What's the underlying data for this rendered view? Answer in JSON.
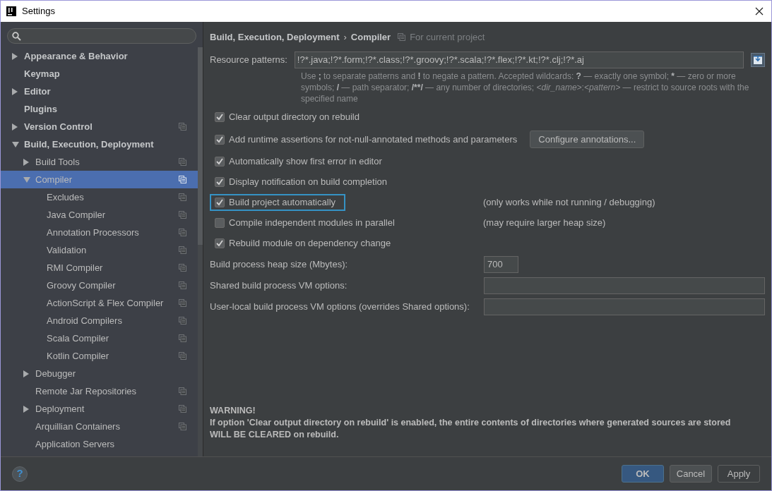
{
  "window": {
    "title": "Settings"
  },
  "sidebar": {
    "items": [
      {
        "label": "Appearance & Behavior",
        "kind": "folder",
        "expanded": false,
        "project_icon": false,
        "selected": false
      },
      {
        "label": "Keymap",
        "kind": "page",
        "project_icon": false,
        "selected": false
      },
      {
        "label": "Editor",
        "kind": "folder",
        "expanded": false,
        "project_icon": false,
        "selected": false
      },
      {
        "label": "Plugins",
        "kind": "page",
        "project_icon": false,
        "selected": false
      },
      {
        "label": "Version Control",
        "kind": "folder",
        "expanded": false,
        "project_icon": true,
        "selected": false
      },
      {
        "label": "Build, Execution, Deployment",
        "kind": "folder",
        "expanded": true,
        "project_icon": false,
        "selected": false,
        "children": [
          {
            "label": "Build Tools",
            "kind": "folder",
            "expanded": false,
            "project_icon": true,
            "selected": false
          },
          {
            "label": "Compiler",
            "kind": "folder",
            "expanded": true,
            "project_icon": true,
            "selected": true,
            "children": [
              {
                "label": "Excludes",
                "kind": "page",
                "project_icon": true,
                "selected": false
              },
              {
                "label": "Java Compiler",
                "kind": "page",
                "project_icon": true,
                "selected": false
              },
              {
                "label": "Annotation Processors",
                "kind": "page",
                "project_icon": true,
                "selected": false
              },
              {
                "label": "Validation",
                "kind": "page",
                "project_icon": true,
                "selected": false
              },
              {
                "label": "RMI Compiler",
                "kind": "page",
                "project_icon": true,
                "selected": false
              },
              {
                "label": "Groovy Compiler",
                "kind": "page",
                "project_icon": true,
                "selected": false
              },
              {
                "label": "ActionScript & Flex Compiler",
                "kind": "page",
                "project_icon": true,
                "selected": false
              },
              {
                "label": "Android Compilers",
                "kind": "page",
                "project_icon": true,
                "selected": false
              },
              {
                "label": "Scala Compiler",
                "kind": "page",
                "project_icon": true,
                "selected": false
              },
              {
                "label": "Kotlin Compiler",
                "kind": "page",
                "project_icon": true,
                "selected": false
              }
            ]
          },
          {
            "label": "Debugger",
            "kind": "folder",
            "expanded": false,
            "project_icon": false,
            "selected": false
          },
          {
            "label": "Remote Jar Repositories",
            "kind": "page",
            "project_icon": true,
            "selected": false
          },
          {
            "label": "Deployment",
            "kind": "folder",
            "expanded": false,
            "project_icon": true,
            "selected": false
          },
          {
            "label": "Arquillian Containers",
            "kind": "page",
            "project_icon": true,
            "selected": false
          },
          {
            "label": "Application Servers",
            "kind": "page",
            "project_icon": false,
            "selected": false
          }
        ]
      }
    ]
  },
  "breadcrumb": {
    "parent": "Build, Execution, Deployment",
    "separator": "›",
    "current": "Compiler",
    "scope": "For current project"
  },
  "resource_patterns": {
    "label": "Resource patterns:",
    "value": "!?*.java;!?*.form;!?*.class;!?*.groovy;!?*.scala;!?*.flex;!?*.kt;!?*.clj;!?*.aj",
    "hint": [
      {
        "text": "Use ",
        "kind": "text"
      },
      {
        "text": ";",
        "kind": "symbol"
      },
      {
        "text": " to separate patterns and ",
        "kind": "text"
      },
      {
        "text": "!",
        "kind": "symbol"
      },
      {
        "text": " to negate a pattern. Accepted wildcards: ",
        "kind": "text"
      },
      {
        "text": "?",
        "kind": "symbol"
      },
      {
        "text": " — exactly one symbol; ",
        "kind": "text"
      },
      {
        "text": "*",
        "kind": "symbol"
      },
      {
        "text": " — zero or more symbols; ",
        "kind": "text"
      },
      {
        "text": "/",
        "kind": "symbol"
      },
      {
        "text": " — path separator; ",
        "kind": "text"
      },
      {
        "text": "/**/",
        "kind": "symbol"
      },
      {
        "text": " — any number of directories; ",
        "kind": "text"
      },
      {
        "text": "<dir_name>",
        "kind": "placeholder"
      },
      {
        "text": ":",
        "kind": "text"
      },
      {
        "text": "<pattern>",
        "kind": "placeholder"
      },
      {
        "text": " — restrict to source roots with the specified name",
        "kind": "text"
      }
    ]
  },
  "options": [
    {
      "kind": "checkbox",
      "label": "Clear output directory on rebuild",
      "checked": true,
      "focused": false
    },
    {
      "kind": "checkbox",
      "label": "Add runtime assertions for not-null-annotated methods and parameters",
      "checked": true,
      "focused": false,
      "button": "Configure annotations..."
    },
    {
      "kind": "checkbox",
      "label": "Automatically show first error in editor",
      "checked": true,
      "focused": false
    },
    {
      "kind": "checkbox",
      "label": "Display notification on build completion",
      "checked": true,
      "focused": false
    },
    {
      "kind": "checkbox",
      "label": "Build project automatically",
      "checked": true,
      "focused": true,
      "note": "(only works while not running / debugging)"
    },
    {
      "kind": "checkbox",
      "label": "Compile independent modules in parallel",
      "checked": false,
      "focused": false,
      "note": "(may require larger heap size)"
    },
    {
      "kind": "checkbox",
      "label": "Rebuild module on dependency change",
      "checked": true,
      "focused": false
    },
    {
      "kind": "field",
      "label": "Build process heap size (Mbytes):",
      "value": "700",
      "wide": false
    },
    {
      "kind": "field",
      "label": "Shared build process VM options:",
      "wide": true
    },
    {
      "kind": "field",
      "label": "User-local build process VM options (overrides Shared options):",
      "wide": true
    }
  ],
  "warning": {
    "title": "WARNING!",
    "lines": [
      "If option 'Clear output directory on rebuild' is enabled, the entire contents of directories where generated sources are stored",
      "WILL BE CLEARED on rebuild."
    ]
  },
  "help_button": {
    "label": "?"
  },
  "buttons": [
    {
      "label": "OK",
      "default": true,
      "disabled": false
    },
    {
      "label": "Cancel",
      "default": false,
      "disabled": false
    },
    {
      "label": "Apply",
      "default": false,
      "disabled": true
    }
  ]
}
